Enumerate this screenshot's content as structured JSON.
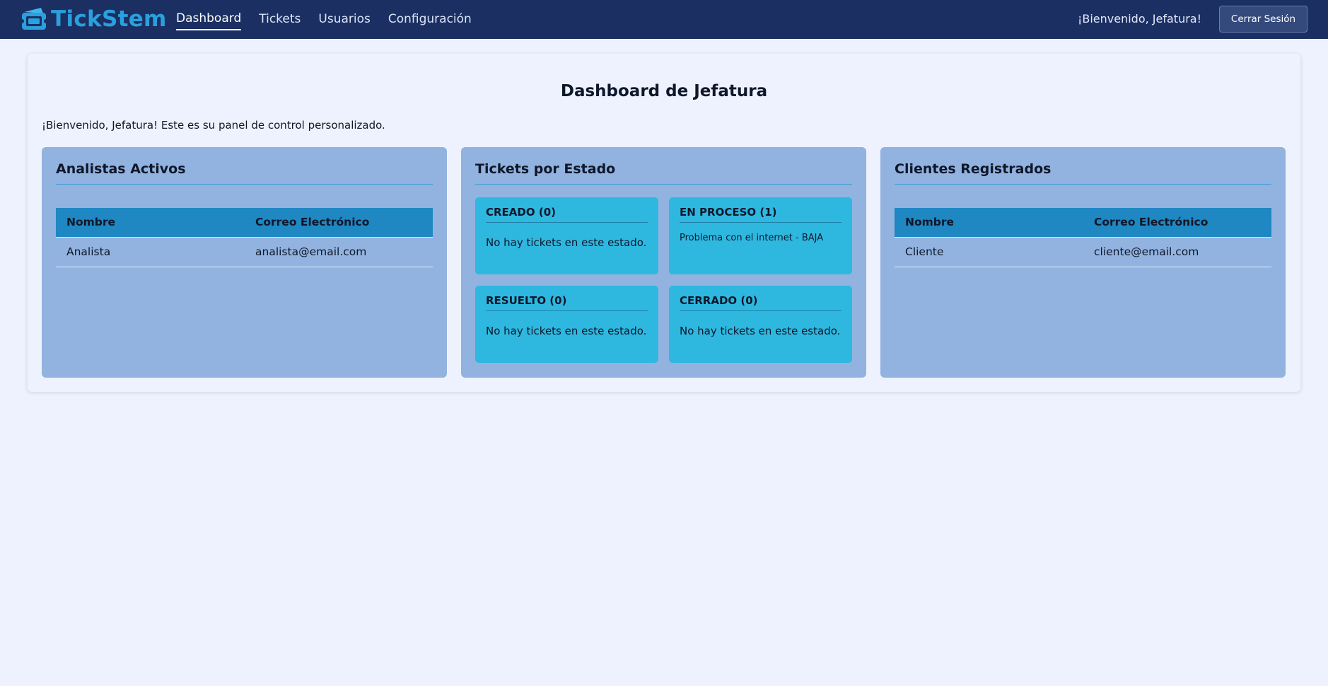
{
  "brand": {
    "name": "TickStem",
    "logo_icon": "ticket-icon"
  },
  "nav": {
    "items": [
      {
        "label": "Dashboard",
        "active": true
      },
      {
        "label": "Tickets",
        "active": false
      },
      {
        "label": "Usuarios",
        "active": false
      },
      {
        "label": "Configuración",
        "active": false
      }
    ],
    "welcome": "¡Bienvenido, Jefatura!",
    "logout_label": "Cerrar Sesión"
  },
  "page": {
    "title": "Dashboard de Jefatura",
    "subtitle": "¡Bienvenido, Jefatura! Este es su panel de control personalizado."
  },
  "analysts": {
    "title": "Analistas Activos",
    "columns": [
      "Nombre",
      "Correo Electrónico"
    ],
    "rows": [
      {
        "name": "Analista",
        "email": "analista@email.com"
      }
    ]
  },
  "tickets": {
    "title": "Tickets por Estado",
    "states": [
      {
        "label": "CREADO (0)",
        "empty_text": "No hay tickets en este estado.",
        "items": []
      },
      {
        "label": "EN PROCESO (1)",
        "empty_text": "",
        "items": [
          "Problema con el internet - BAJA"
        ]
      },
      {
        "label": "RESUELTO (0)",
        "empty_text": "No hay tickets en este estado.",
        "items": []
      },
      {
        "label": "CERRADO (0)",
        "empty_text": "No hay tickets en este estado.",
        "items": []
      }
    ]
  },
  "clients": {
    "title": "Clientes Registrados",
    "columns": [
      "Nombre",
      "Correo Electrónico"
    ],
    "rows": [
      {
        "name": "Cliente",
        "email": "cliente@email.com"
      }
    ]
  },
  "colors": {
    "navbar_bg": "#1b2f63",
    "brand": "#2aa0dd",
    "page_bg": "#eef2fe",
    "card_bg": "#92b3df",
    "table_header": "#1f87c2",
    "status_box": "#2eb8e0"
  }
}
